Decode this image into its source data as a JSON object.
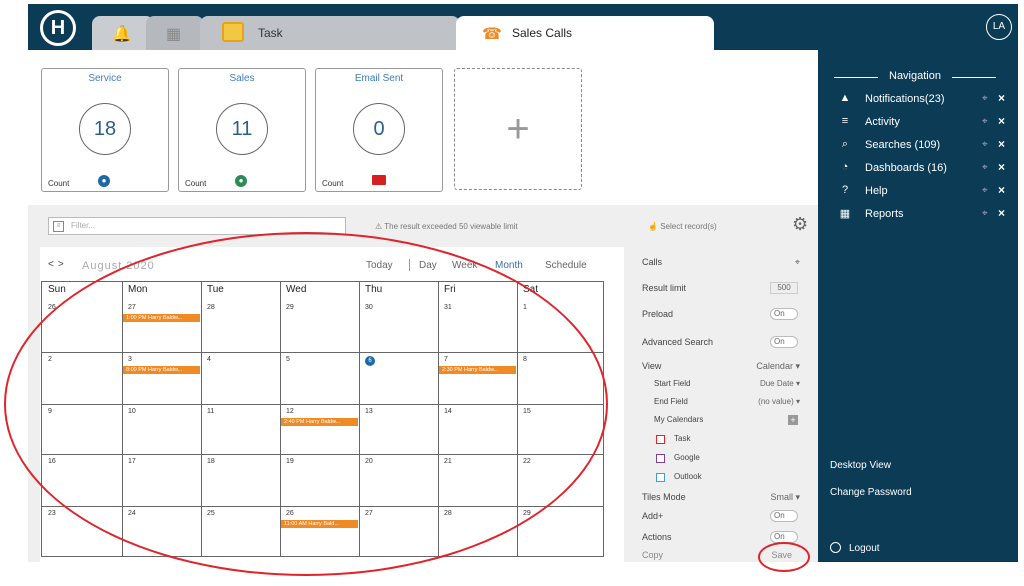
{
  "header": {
    "logo_text": "H",
    "tabs": [
      {
        "label": "",
        "icon": "bell-icon"
      },
      {
        "label": "",
        "icon": "calendar-icon"
      },
      {
        "label": "Task",
        "icon": "task-icon"
      },
      {
        "label": "Sales Calls",
        "icon": "phone-icon"
      }
    ],
    "avatar": "LA"
  },
  "tiles": [
    {
      "title": "Service",
      "count": "18",
      "count_label": "Count",
      "icon": "user-icon",
      "icon_color": "#1e6aa8"
    },
    {
      "title": "Sales",
      "count": "11",
      "count_label": "Count",
      "icon": "user-icon",
      "icon_color": "#2e8b57"
    },
    {
      "title": "Email Sent",
      "count": "0",
      "count_label": "Count",
      "icon": "screen-icon",
      "icon_color": "#d62020"
    }
  ],
  "add_tile_symbol": "+",
  "toolbar": {
    "filter_placeholder": "Filter...",
    "limit_text": "The result exceeded 50 viewable limit",
    "select_records": "Select record(s)"
  },
  "calendar": {
    "month_label": "August 2020",
    "views": [
      "Today",
      "Day",
      "Week",
      "Month",
      "Schedule"
    ],
    "active_view": "Month",
    "weekdays": [
      "Sun",
      "Mon",
      "Tue",
      "Wed",
      "Thu",
      "Fri",
      "Sat"
    ],
    "weeks": [
      [
        "26",
        "27",
        "28",
        "29",
        "30",
        "31",
        "1"
      ],
      [
        "2",
        "3",
        "4",
        "5",
        "6",
        "7",
        "8"
      ],
      [
        "9",
        "10",
        "11",
        "12",
        "13",
        "14",
        "15"
      ],
      [
        "16",
        "17",
        "18",
        "19",
        "20",
        "21",
        "22"
      ],
      [
        "23",
        "24",
        "25",
        "26",
        "27",
        "28",
        "29"
      ]
    ],
    "today": {
      "week": 1,
      "day": 4
    },
    "events": [
      {
        "week": 0,
        "day": 1,
        "label": "1:00 PM Harry Baldw..."
      },
      {
        "week": 1,
        "day": 1,
        "label": "8:00 PM Harry Baldw..."
      },
      {
        "week": 1,
        "day": 5,
        "label": "2:30 PM Harry Baldw..."
      },
      {
        "week": 2,
        "day": 3,
        "label": "2:40 PM Harry Baldw..."
      },
      {
        "week": 4,
        "day": 3,
        "label": "11:00 AM Harry Bald..."
      }
    ],
    "event_color": "#f08a24"
  },
  "settings": {
    "title": "Calls",
    "result_limit_label": "Result limit",
    "result_limit_value": "500",
    "preload_label": "Preload",
    "preload_value": "On",
    "advanced_search_label": "Advanced Search",
    "advanced_search_value": "On",
    "view_label": "View",
    "view_value": "Calendar",
    "start_field_label": "Start Field",
    "start_field_value": "Due Date",
    "end_field_label": "End Field",
    "end_field_value": "(no value)",
    "my_calendars_label": "My Calendars",
    "calendars": [
      {
        "label": "Task",
        "color": "#e0242b"
      },
      {
        "label": "Google",
        "color": "#7b3fa0"
      },
      {
        "label": "Outlook",
        "color": "#3aa0d8"
      }
    ],
    "tiles_mode_label": "Tiles Mode",
    "tiles_mode_value": "Small",
    "add_label": "Add+",
    "add_value": "On",
    "actions_label": "Actions",
    "actions_value": "On",
    "copy_label": "Copy",
    "save_label": "Save"
  },
  "navigation": {
    "heading": "Navigation",
    "items": [
      {
        "label": "Notifications(23)",
        "icon": "bell-icon"
      },
      {
        "label": "Activity",
        "icon": "menu-icon"
      },
      {
        "label": "Searches (109)",
        "icon": "search-icon"
      },
      {
        "label": "Dashboards (16)",
        "icon": "gauge-icon"
      },
      {
        "label": "Help",
        "icon": "help-icon"
      },
      {
        "label": "Reports",
        "icon": "table-icon"
      }
    ],
    "desktop_view": "Desktop View",
    "change_password": "Change Password",
    "logout": "Logout"
  },
  "colors": {
    "navy": "#0b3b55",
    "accent_orange": "#f08a24",
    "annotation_red": "#e0242b"
  }
}
